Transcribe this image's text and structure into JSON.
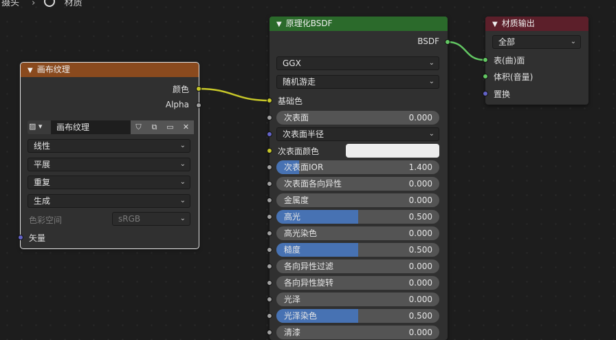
{
  "breadcrumb": {
    "item1": "摄头",
    "item2": "材质"
  },
  "links_colors": {
    "yellow": "#c7c729",
    "green": "#63c763"
  },
  "image_node": {
    "title": "画布纹理",
    "header_color": "#8a4a1e",
    "outputs": [
      "颜色",
      "Alpha"
    ],
    "image_name": "画布纹理",
    "interpolation": "线性",
    "projection": "平展",
    "extension": "重复",
    "source": "生成",
    "colorspace_label": "色彩空间",
    "colorspace_value": "sRGB",
    "vector_label": "矢量"
  },
  "bsdf_node": {
    "title": "原理化BSDF",
    "header_color": "#2b6a2b",
    "output": "BSDF",
    "distribution": "GGX",
    "subsurface_method": "随机游走",
    "base_color_label": "基础色",
    "subsurface": {
      "label": "次表面",
      "value": "0.000",
      "fraction": 0
    },
    "subsurface_radius": "次表面半径",
    "subsurface_color": "次表面颜色",
    "rows": [
      {
        "label": "次表面IOR",
        "value": "1.400",
        "fraction": 0.14
      },
      {
        "label": "次表面各向异性",
        "value": "0.000",
        "fraction": 0
      },
      {
        "label": "金属度",
        "value": "0.000",
        "fraction": 0
      },
      {
        "label": "高光",
        "value": "0.500",
        "fraction": 0.5
      },
      {
        "label": "高光染色",
        "value": "0.000",
        "fraction": 0
      },
      {
        "label": "糙度",
        "value": "0.500",
        "fraction": 0.5
      },
      {
        "label": "各向异性过滤",
        "value": "0.000",
        "fraction": 0
      },
      {
        "label": "各向异性旋转",
        "value": "0.000",
        "fraction": 0
      },
      {
        "label": "光泽",
        "value": "0.000",
        "fraction": 0
      },
      {
        "label": "光泽染色",
        "value": "0.500",
        "fraction": 0.5
      },
      {
        "label": "清漆",
        "value": "0.000",
        "fraction": 0
      }
    ]
  },
  "output_node": {
    "title": "材质输出",
    "header_color": "#5c1f2a",
    "target": "全部",
    "inputs": [
      "表(曲)面",
      "体积(音量)",
      "置换"
    ]
  }
}
